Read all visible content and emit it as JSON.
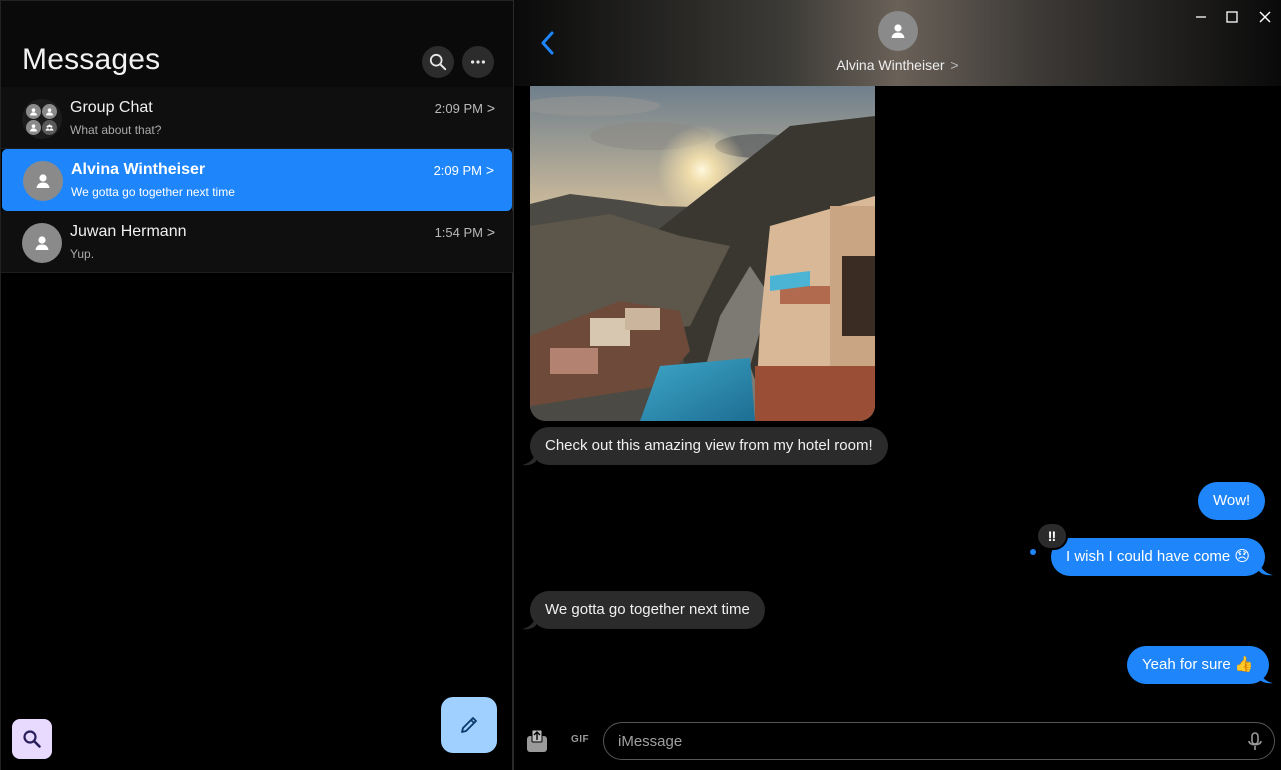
{
  "sidebar": {
    "title": "Messages",
    "search_icon": "search-icon",
    "more_icon": "more-horizontal-icon",
    "conversations": [
      {
        "name": "Group Chat",
        "preview": "What about that?",
        "time": "2:09 PM",
        "selected": false,
        "avatar": "group-avatar-icon"
      },
      {
        "name": "Alvina Wintheiser",
        "preview": "We gotta go together next time",
        "time": "2:09 PM",
        "selected": true,
        "avatar": "person-avatar-icon"
      },
      {
        "name": "Juwan Hermann",
        "preview": "Yup.",
        "time": "1:54 PM",
        "selected": false,
        "avatar": "person-avatar-icon"
      }
    ],
    "chevron": ">",
    "search_fab_icon": "search-icon",
    "compose_fab_icon": "pencil-icon"
  },
  "chat": {
    "contact_name": "Alvina Wintheiser",
    "contact_chevron": ">",
    "messages": [
      {
        "direction": "in",
        "type": "image",
        "alt": "sunset-hotel-view-photo"
      },
      {
        "direction": "in",
        "text": "Check out this amazing view from my hotel room!"
      },
      {
        "direction": "out",
        "text": "Wow!"
      },
      {
        "direction": "out",
        "text": "I wish I could have come 😞",
        "reaction": "‼"
      },
      {
        "direction": "in",
        "text": "We gotta go together next time"
      },
      {
        "direction": "out",
        "text": "Yeah for sure 👍"
      }
    ],
    "composer": {
      "gif_label": "GIF",
      "placeholder": "iMessage"
    }
  },
  "colors": {
    "accent": "#1e86fa",
    "incoming_bubble": "#2b2b2b",
    "search_fab": "#e8d9ff",
    "compose_fab": "#9fd0ff"
  }
}
